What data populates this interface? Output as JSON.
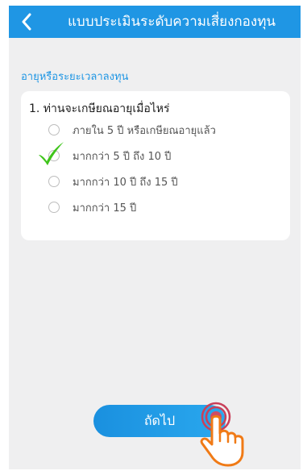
{
  "header": {
    "back_icon": "chevron-left-icon",
    "title": "แบบประเมินระดับความเสี่ยงกองทุน"
  },
  "section": {
    "title": "อายุหรือระยะเวลาลงทุน"
  },
  "question": {
    "text": "1. ท่านจะเกษียณอายุเมื่อไหร่",
    "options": [
      {
        "label": "ภายใน 5 ปี หรือเกษียณอายุแล้ว",
        "selected": false
      },
      {
        "label": "มากกว่า 5 ปี ถึง 10 ปี",
        "selected": true
      },
      {
        "label": "มากกว่า 10 ปี ถึง 15 ปี",
        "selected": false
      },
      {
        "label": "มากกว่า 15 ปี",
        "selected": false
      }
    ]
  },
  "footer": {
    "next_label": "ถัดไป"
  },
  "colors": {
    "accent": "#1f96e4",
    "check": "#3fc41b",
    "background": "#efeff0"
  },
  "icons": {
    "selected_mark": "checkmark-icon",
    "tap_hint": "hand-pointer-icon"
  }
}
